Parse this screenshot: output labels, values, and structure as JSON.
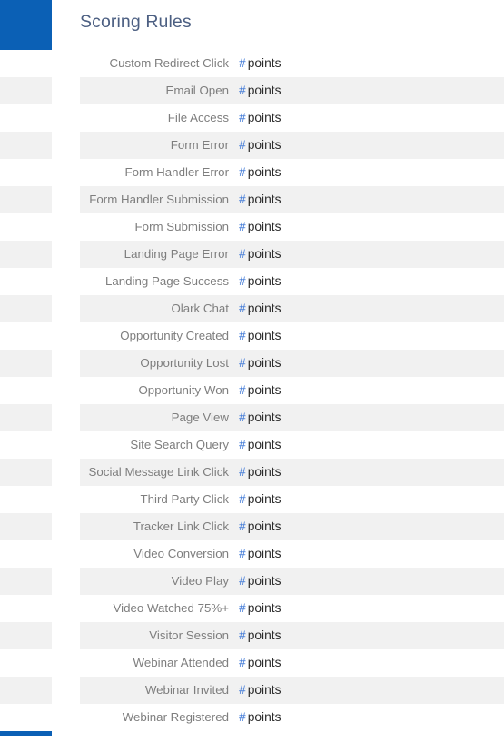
{
  "theme": {
    "rail_color": "#0b60b5",
    "stripe_color": "#f1f1f1",
    "title_color": "#4c5f82",
    "label_color": "#7e7e7e",
    "value_color": "#2b2b2b",
    "hash_color": "#3d77d6"
  },
  "header": {
    "title": "Scoring Rules"
  },
  "rules": {
    "value_prefix": "#",
    "value_unit": "points",
    "items": [
      {
        "label": "Custom Redirect Click",
        "hash": "#",
        "unit": "points"
      },
      {
        "label": "Email Open",
        "hash": "#",
        "unit": "points"
      },
      {
        "label": "File Access",
        "hash": "#",
        "unit": "points"
      },
      {
        "label": "Form Error",
        "hash": "#",
        "unit": "points"
      },
      {
        "label": "Form Handler Error",
        "hash": "#",
        "unit": "points"
      },
      {
        "label": "Form Handler Submission",
        "hash": "#",
        "unit": "points"
      },
      {
        "label": "Form Submission",
        "hash": "#",
        "unit": "points"
      },
      {
        "label": "Landing Page Error",
        "hash": "#",
        "unit": "points"
      },
      {
        "label": "Landing Page Success",
        "hash": "#",
        "unit": "points"
      },
      {
        "label": "Olark Chat",
        "hash": "#",
        "unit": "points"
      },
      {
        "label": "Opportunity Created",
        "hash": "#",
        "unit": "points"
      },
      {
        "label": "Opportunity Lost",
        "hash": "#",
        "unit": "points"
      },
      {
        "label": "Opportunity Won",
        "hash": "#",
        "unit": "points"
      },
      {
        "label": "Page View",
        "hash": "#",
        "unit": "points"
      },
      {
        "label": "Site Search Query",
        "hash": "#",
        "unit": "points"
      },
      {
        "label": "Social Message Link Click",
        "hash": "#",
        "unit": "points"
      },
      {
        "label": "Third Party Click",
        "hash": "#",
        "unit": "points"
      },
      {
        "label": "Tracker Link Click",
        "hash": "#",
        "unit": "points"
      },
      {
        "label": "Video Conversion",
        "hash": "#",
        "unit": "points"
      },
      {
        "label": "Video Play",
        "hash": "#",
        "unit": "points"
      },
      {
        "label": "Video Watched 75%+",
        "hash": "#",
        "unit": "points"
      },
      {
        "label": "Visitor Session",
        "hash": "#",
        "unit": "points"
      },
      {
        "label": "Webinar Attended",
        "hash": "#",
        "unit": "points"
      },
      {
        "label": "Webinar Invited",
        "hash": "#",
        "unit": "points"
      },
      {
        "label": "Webinar Registered",
        "hash": "#",
        "unit": "points"
      }
    ]
  }
}
